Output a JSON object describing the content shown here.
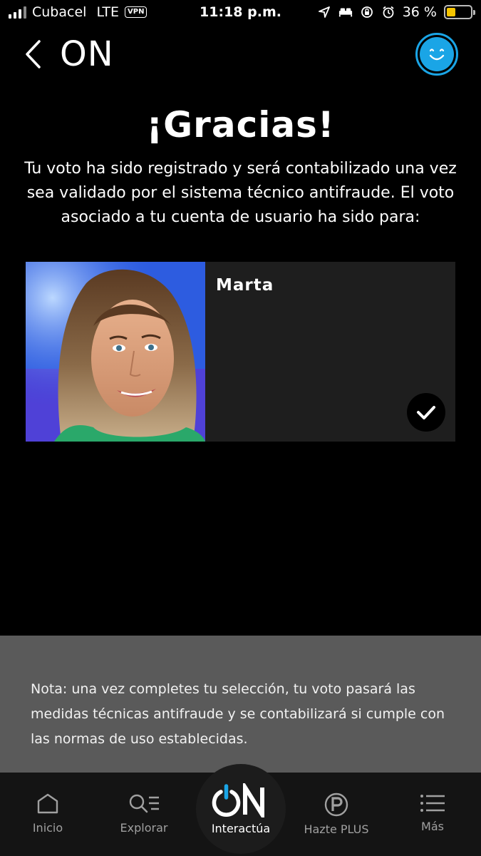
{
  "status_bar": {
    "carrier": "Cubacel",
    "network": "LTE",
    "vpn": "VPN",
    "time": "11:18 p.m.",
    "battery": "36 %",
    "battery_level": 0.36,
    "battery_color": "#f5c400"
  },
  "header": {
    "title": "ON",
    "back_icon": "chevron-left-icon",
    "profile_icon": "smiley-icon",
    "accent_color": "#1aa5e6"
  },
  "thanks": {
    "title": "¡Gracias!",
    "message": "Tu voto ha sido registrado y será contabilizado una vez sea validado por el sistema técnico antifraude. El voto asociado a tu cuenta de usuario ha sido para:"
  },
  "candidate": {
    "name": "Marta",
    "selected": true
  },
  "note": {
    "text": "Nota: una vez completes tu selección, tu voto pasará las medidas técnicas antifraude y se contabilizará si cumple con las normas de uso establecidas."
  },
  "tabbar": {
    "items": [
      {
        "label": "Inicio",
        "icon": "home-icon"
      },
      {
        "label": "Explorar",
        "icon": "search-list-icon"
      },
      {
        "label": "Interactúa",
        "icon": "on-logo-icon",
        "active": true
      },
      {
        "label": "Hazte PLUS",
        "icon": "plus-p-icon"
      },
      {
        "label": "Más",
        "icon": "menu-icon"
      }
    ]
  }
}
